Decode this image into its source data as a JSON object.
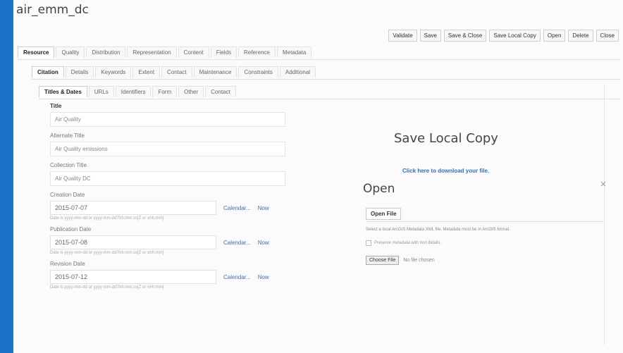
{
  "window": {
    "title": "air_emm_dc"
  },
  "actions": [
    "Validate",
    "Save",
    "Save & Close",
    "Save Local Copy",
    "Open",
    "Delete",
    "Close"
  ],
  "tabs_level1": {
    "items": [
      "Resource",
      "Quality",
      "Distribution",
      "Representation",
      "Content",
      "Fields",
      "Reference",
      "Metadata"
    ],
    "active": 0
  },
  "tabs_level2": {
    "items": [
      "Citation",
      "Details",
      "Keywords",
      "Extent",
      "Contact",
      "Maintenance",
      "Constraints",
      "Additional"
    ],
    "active": 0
  },
  "tabs_level3": {
    "items": [
      "Titles & Dates",
      "URLs",
      "Identifiers",
      "Form",
      "Other",
      "Contact"
    ],
    "active": 0
  },
  "form": {
    "section_title": "Title",
    "title_value": "Air Quality",
    "alternate_title_label": "Alternate Title",
    "alternate_title_value": "Air Quality emissions",
    "collection_title_label": "Collection Title",
    "collection_title_value": "Air Quality DC",
    "calendar_label": "Calendar...",
    "now_label": "Now",
    "date_hint": "Date is yyyy-mm-dd or yyyy-mm-ddThh:mm:ss[Z or ±hh:mm]",
    "dates": [
      {
        "label": "Creation Date",
        "value": "2015-07-07"
      },
      {
        "label": "Publication Date",
        "value": "2015-07-08"
      },
      {
        "label": "Revision Date",
        "value": "2015-07-12"
      }
    ]
  },
  "save_local": {
    "title": "Save Local Copy",
    "link": "Click here to download your file."
  },
  "open_dialog": {
    "title": "Open",
    "close": "×",
    "tab": "Open File",
    "description": "Select a local ArcGIS Metadata XML file. Metadata must be in ArcGIS format.",
    "checkbox_label": "Preserve metadata with text details.",
    "choose_file_label": "Choose File",
    "no_file_text": "No file chosen"
  }
}
